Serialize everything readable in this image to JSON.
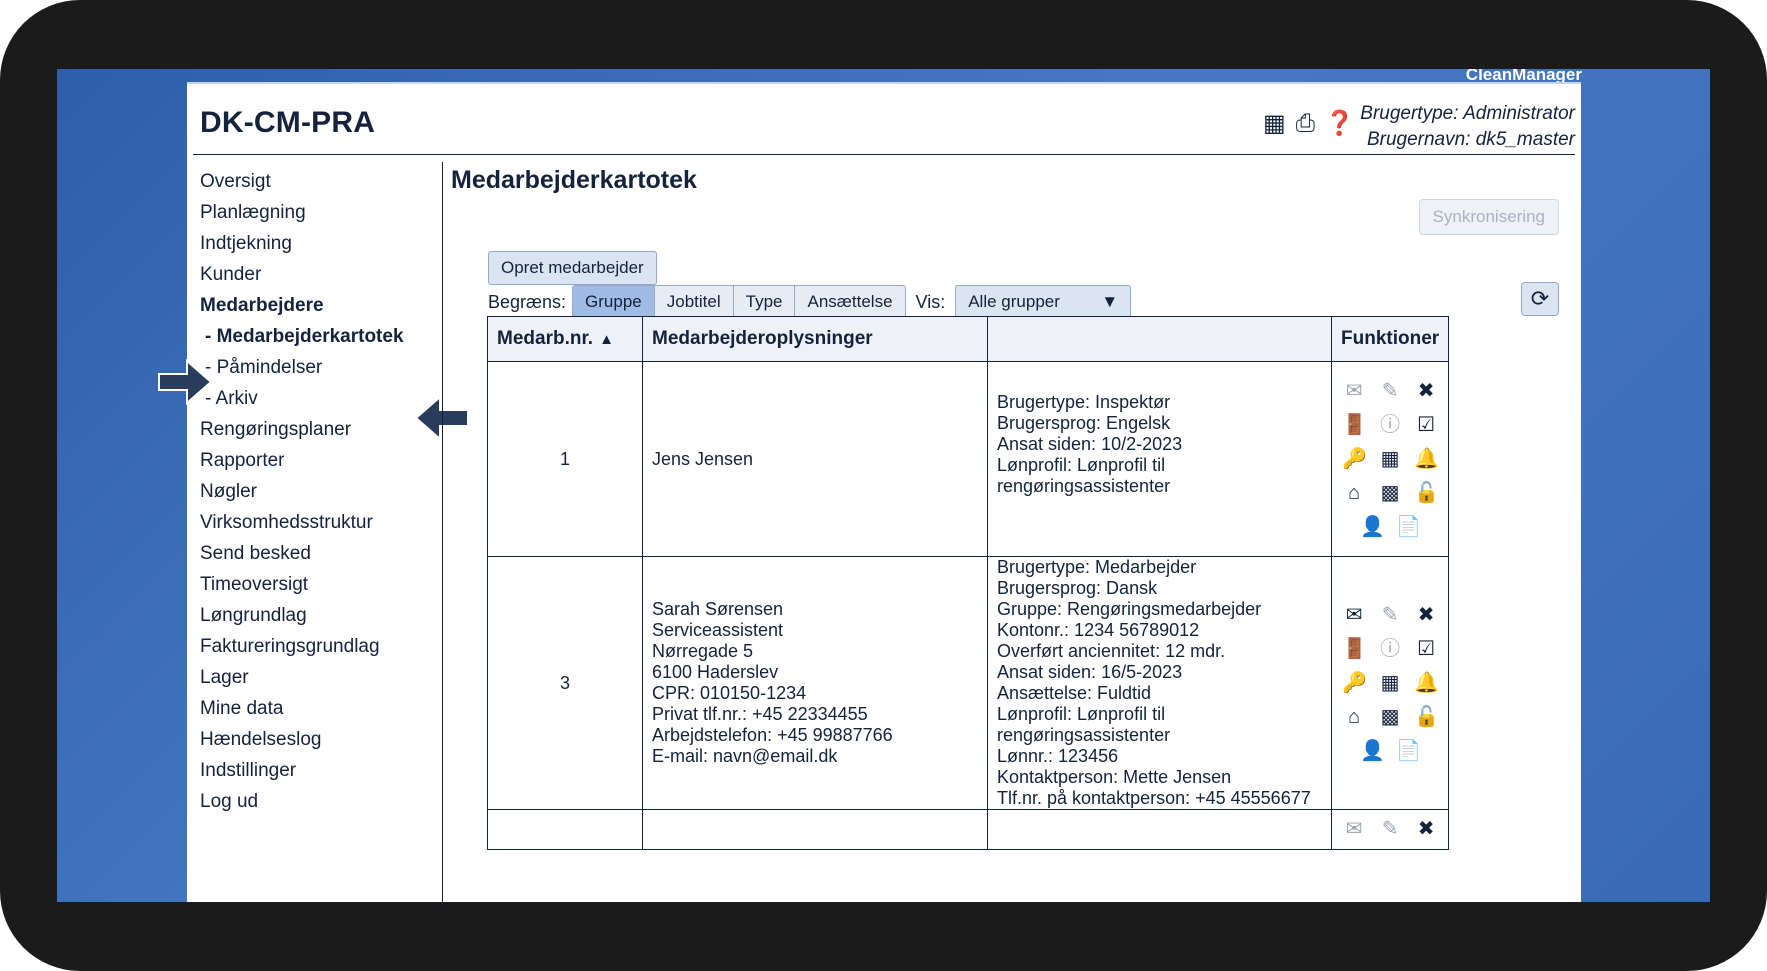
{
  "brand": "CleanManager",
  "site_title": "DK-CM-PRA",
  "header": {
    "icons": [
      "table-icon",
      "print-icon",
      "help-icon"
    ],
    "user_type": "Brugertype: Administrator",
    "user_name": "Brugernavn: dk5_master"
  },
  "sidebar": {
    "items": [
      {
        "label": "Oversigt"
      },
      {
        "label": "Planlægning"
      },
      {
        "label": "Indtjekning"
      },
      {
        "label": "Kunder"
      },
      {
        "label": "Medarbejdere"
      },
      {
        "label": "- Medarbejderkartotek"
      },
      {
        "label": "- Påmindelser"
      },
      {
        "label": "- Arkiv"
      },
      {
        "label": "Rengøringsplaner"
      },
      {
        "label": "Rapporter"
      },
      {
        "label": "Nøgler"
      },
      {
        "label": "Virksomhedsstruktur"
      },
      {
        "label": "Send besked"
      },
      {
        "label": "Timeoversigt"
      },
      {
        "label": "Løngrundlag"
      },
      {
        "label": "Faktureringsgrundlag"
      },
      {
        "label": "Lager"
      },
      {
        "label": "Mine data"
      },
      {
        "label": "Hændelseslog"
      },
      {
        "label": "Indstillinger"
      },
      {
        "label": "Log ud"
      }
    ]
  },
  "main": {
    "heading": "Medarbejderkartotek",
    "sync_label": "Synkronisering",
    "create_label": "Opret medarbejder",
    "filter_label": "Begræns:",
    "filters": [
      "Gruppe",
      "Jobtitel",
      "Type",
      "Ansættelse"
    ],
    "selected_filter": "Gruppe",
    "vis_label": "Vis:",
    "vis_value": "Alle grupper",
    "table": {
      "headers": [
        "Medarb.nr.",
        "Medarbejderoplysninger",
        "",
        "Funktioner"
      ],
      "rows": [
        {
          "num": "1",
          "info": [
            "Jens Jensen"
          ],
          "details": [
            "Brugertype: Inspektør",
            "Brugersprog: Engelsk",
            "Ansat siden: 10/2-2023",
            "Lønprofil: Lønprofil til rengøringsassistenter"
          ]
        },
        {
          "num": "3",
          "info": [
            "Sarah Sørensen",
            "Serviceassistent",
            "Nørregade 5",
            "6100 Haderslev",
            "CPR: 010150-1234",
            "Privat tlf.nr.: +45 22334455",
            "Arbejdstelefon: +45 99887766",
            "E-mail: navn@email.dk"
          ],
          "details": [
            "Brugertype: Medarbejder",
            "Brugersprog: Dansk",
            "Gruppe: Rengøringsmedarbejder",
            "Kontonr.: 1234 56789012",
            "Overført anciennitet: 12 mdr.",
            "Ansat siden: 16/5-2023",
            "Ansættelse: Fuldtid",
            "Lønprofil: Lønprofil til rengøringsassistenter",
            "Lønnr.: 123456",
            "Kontaktperson: Mette Jensen",
            "Tlf.nr. på kontaktperson: +45 45556677"
          ]
        }
      ]
    }
  },
  "colors": {
    "accent": "#14233b",
    "selected": "#9fbbe6",
    "desktop": "#3a6ab4"
  }
}
